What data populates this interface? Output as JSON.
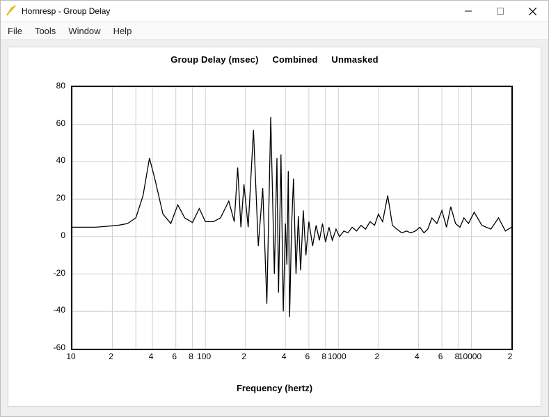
{
  "window": {
    "title": "Hornresp - Group Delay"
  },
  "menubar": {
    "items": [
      "File",
      "Tools",
      "Window",
      "Help"
    ]
  },
  "chart": {
    "title_main": "Group Delay (msec)",
    "title_sub1": "Combined",
    "title_sub2": "Unmasked",
    "xlabel": "Frequency (hertz)"
  },
  "chart_data": {
    "type": "line",
    "title": "Group Delay (msec)   Combined   Unmasked",
    "xlabel": "Frequency (hertz)",
    "ylabel": "Group Delay (msec)",
    "x_scale": "log",
    "xlim": [
      10,
      20000
    ],
    "ylim": [
      -60,
      80
    ],
    "y_ticks": [
      -60,
      -40,
      -20,
      0,
      20,
      40,
      60,
      80
    ],
    "x_ticks": [
      10,
      20,
      30,
      40,
      60,
      80,
      100,
      200,
      400,
      600,
      800,
      1000,
      2000,
      4000,
      6000,
      8000,
      10000,
      20000
    ],
    "x_tick_labels": [
      "10",
      "2",
      "",
      "4",
      "6",
      "8",
      "100",
      "2",
      "4",
      "6",
      "8",
      "1000",
      "2",
      "4",
      "6",
      "8",
      "10000",
      "2"
    ],
    "series": [
      {
        "name": "Group Delay",
        "x": [
          10,
          12,
          15,
          18,
          22,
          26,
          30,
          34,
          38,
          42,
          48,
          55,
          62,
          70,
          80,
          90,
          100,
          115,
          130,
          150,
          165,
          175,
          185,
          195,
          210,
          230,
          250,
          270,
          290,
          310,
          330,
          345,
          355,
          370,
          385,
          400,
          410,
          420,
          430,
          445,
          460,
          480,
          500,
          520,
          545,
          570,
          600,
          640,
          680,
          720,
          760,
          800,
          850,
          900,
          960,
          1020,
          1100,
          1180,
          1270,
          1370,
          1480,
          1600,
          1730,
          1870,
          2000,
          2150,
          2350,
          2550,
          2750,
          3000,
          3250,
          3500,
          3800,
          4100,
          4400,
          4700,
          5050,
          5500,
          6000,
          6500,
          7000,
          7600,
          8200,
          8800,
          9500,
          10500,
          12000,
          14000,
          16000,
          18000,
          20000
        ],
        "y": [
          5,
          5,
          5,
          5.5,
          6,
          7,
          10,
          22,
          42,
          30,
          12,
          7,
          17,
          10,
          7.5,
          15,
          8,
          8,
          10,
          19,
          8,
          37,
          5,
          28,
          5,
          57,
          -5,
          26,
          -36,
          64,
          -20,
          42,
          -30,
          44,
          -40,
          7,
          -15,
          35,
          -43,
          6,
          31,
          -20,
          11,
          -18,
          14,
          -10,
          8,
          -5,
          6,
          -2,
          7,
          -3,
          5,
          -2,
          4,
          0,
          3,
          2,
          5,
          3,
          6,
          4,
          8,
          6,
          12,
          8,
          22,
          6,
          4,
          2,
          3,
          2,
          3,
          5,
          2,
          4,
          10,
          7,
          14,
          5,
          16,
          7,
          5,
          10,
          7,
          13,
          6,
          4,
          10,
          3,
          5
        ]
      }
    ]
  }
}
